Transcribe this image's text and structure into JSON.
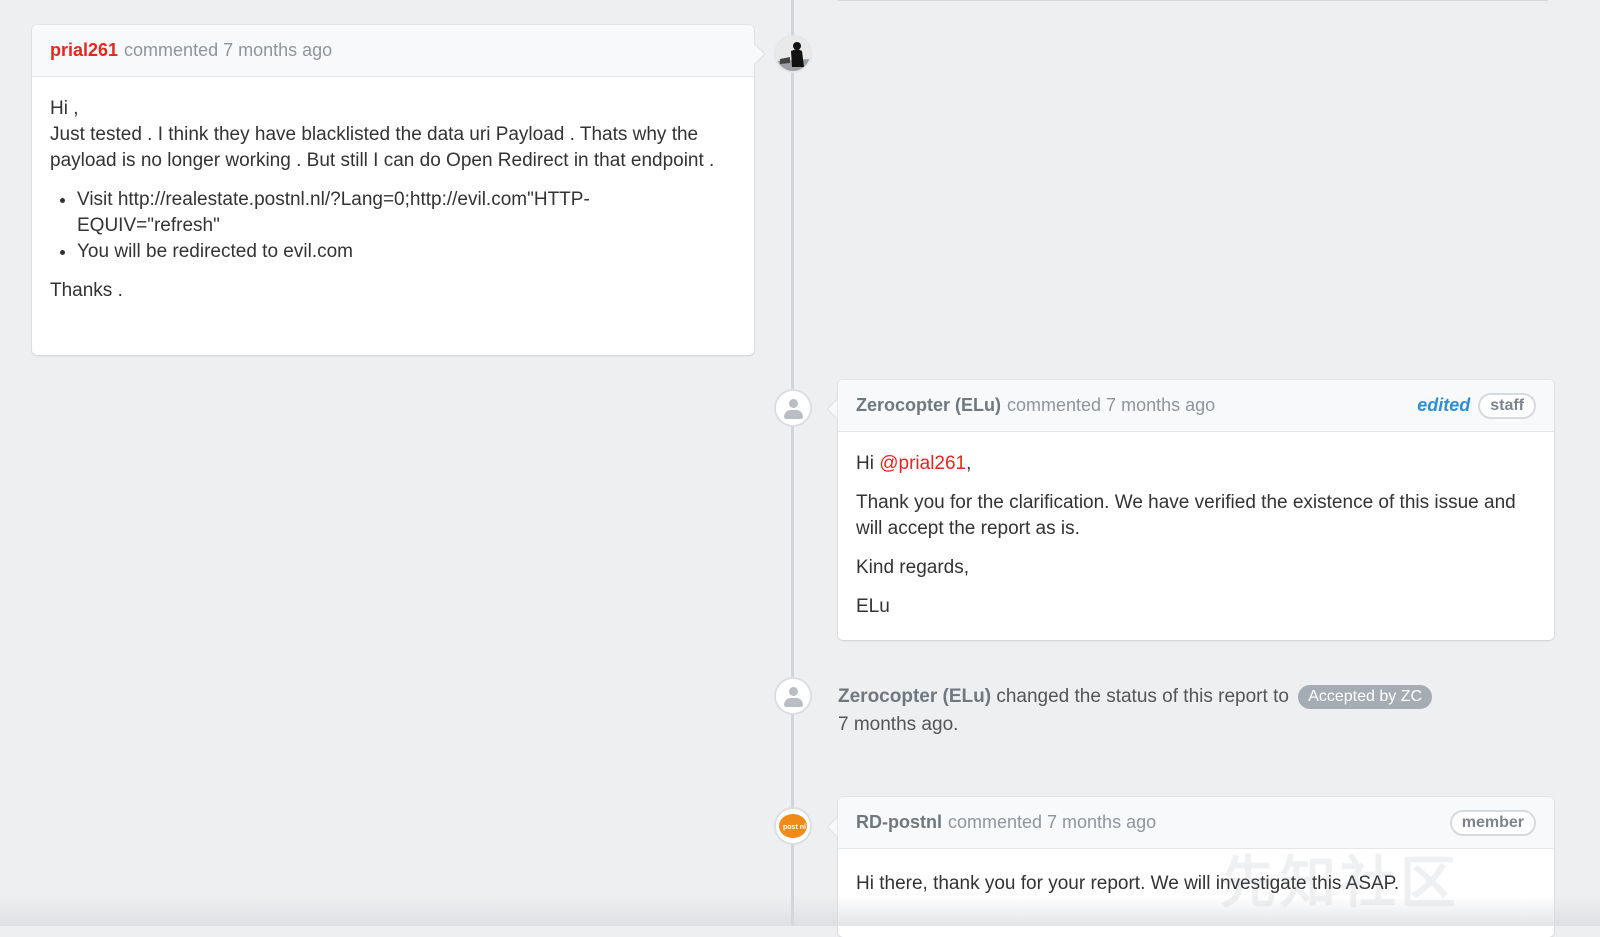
{
  "comments": [
    {
      "author": "prial261",
      "meta": "commented 7 months ago",
      "greeting": "Hi ,",
      "paragraph": "Just tested . I think they have blacklisted the data uri Payload . Thats why the payload is no longer working . But still I can do Open Redirect in that endpoint .",
      "bullets": [
        "Visit http://realestate.postnl.nl/?Lang=0;http://evil.com\"HTTP-EQUIV=\"refresh\"",
        "You will be redirected to evil.com"
      ],
      "closing": "Thanks ."
    },
    {
      "author": "Zerocopter (ELu)",
      "meta": "commented 7 months ago",
      "edited_label": "edited",
      "role": "staff",
      "greeting_prefix": "Hi ",
      "mention": "@prial261",
      "greeting_suffix": ",",
      "paragraph": "Thank you for the clarification. We have verified the existence of this issue and will accept the report as is.",
      "regards": "Kind regards,",
      "signature": "ELu"
    },
    {
      "author": "RD-postnl",
      "meta": "commented 7 months ago",
      "role": "member",
      "body": "Hi there, thank you for your report. We will investigate this ASAP."
    }
  ],
  "status_event": {
    "author": "Zerocopter (ELu)",
    "text": "changed the status of this report to",
    "status": "Accepted by ZC",
    "time": "7 months ago."
  },
  "avatars": {
    "postnl_logo_text": "post nl"
  },
  "watermark": "先知社区",
  "colors": {
    "accent_red": "#e8251f",
    "edited_blue": "#2c8fd6",
    "badge_gray": "#a5acb3",
    "postnl_orange": "#f28a1a"
  }
}
